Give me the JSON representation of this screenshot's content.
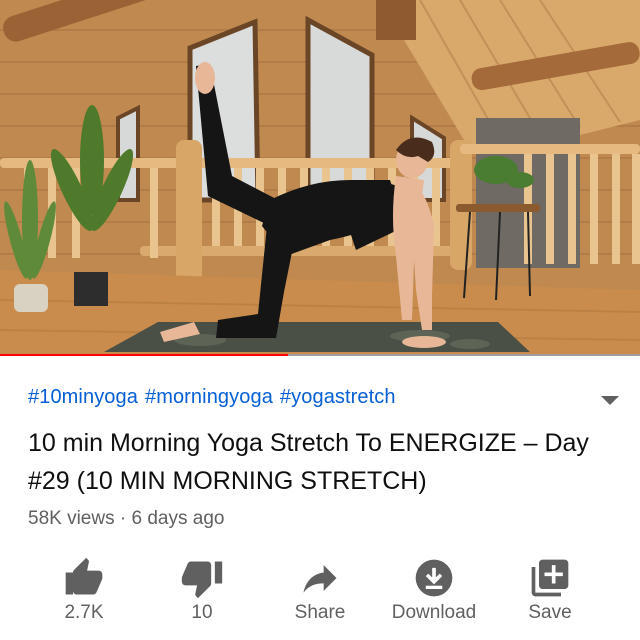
{
  "video": {
    "progress_fraction": 0.45
  },
  "details": {
    "hashtags": [
      "#10minyoga",
      "#morningyoga",
      "#yogastretch"
    ],
    "title": "10 min Morning Yoga Stretch To ENERGIZE – Day #29 (10 MIN MORNING STRETCH)",
    "views": "58K views",
    "separator": "·",
    "age": "6 days ago"
  },
  "actions": {
    "like": {
      "label": "2.7K",
      "icon": "thumb-up-icon"
    },
    "dislike": {
      "label": "10",
      "icon": "thumb-down-icon"
    },
    "share": {
      "label": "Share",
      "icon": "share-arrow-icon"
    },
    "download": {
      "label": "Download",
      "icon": "download-icon"
    },
    "save": {
      "label": "Save",
      "icon": "playlist-add-icon"
    }
  },
  "colors": {
    "link": "#065fd4",
    "progress": "#ff0000",
    "icon": "#606060",
    "text": "#0f0f0f"
  }
}
